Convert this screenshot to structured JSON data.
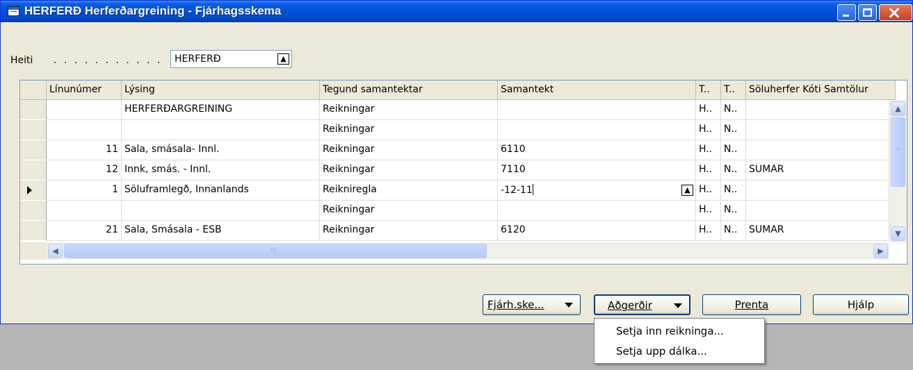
{
  "window": {
    "title": "HERFERÐ Herferðargreining - Fjárhagsskema"
  },
  "header": {
    "heiti_label": "Heiti",
    "heiti_dots": ". . . . . . . . . . .",
    "heiti_value": "HERFERÐ"
  },
  "grid": {
    "columns": {
      "linunumer": "Línunúmer",
      "lysing": "Lýsing",
      "tegund": "Tegund samantektar",
      "samantekt": "Samantekt",
      "t1": "T..",
      "t2": "T..",
      "soluherfer": "Söluherfer Kóti Samtölur"
    },
    "rows": [
      {
        "linunumer": "",
        "lysing": "HERFERÐARGREINING",
        "tegund": "Reikningar",
        "samantekt": "",
        "t1": "H..",
        "t2": "N..",
        "soluherfer": ""
      },
      {
        "linunumer": "",
        "lysing": "",
        "tegund": "Reikningar",
        "samantekt": "",
        "t1": "H..",
        "t2": "N..",
        "soluherfer": ""
      },
      {
        "linunumer": "11",
        "lysing": "Sala, smásala- Innl.",
        "tegund": "Reikningar",
        "samantekt": "6110",
        "t1": "H..",
        "t2": "N..",
        "soluherfer": ""
      },
      {
        "linunumer": "12",
        "lysing": "Innk, smás. - Innl.",
        "tegund": "Reikningar",
        "samantekt": "7110",
        "t1": "H..",
        "t2": "N..",
        "soluherfer": "SUMAR"
      },
      {
        "linunumer": "1",
        "lysing": "Söluframlegð, Innanlands",
        "tegund": "Reikniregla",
        "samantekt": "-12-11",
        "t1": "H..",
        "t2": "N..",
        "soluherfer": ""
      },
      {
        "linunumer": "",
        "lysing": "",
        "tegund": "Reikningar",
        "samantekt": "",
        "t1": "H..",
        "t2": "N..",
        "soluherfer": ""
      },
      {
        "linunumer": "21",
        "lysing": "Sala, Smásala - ESB",
        "tegund": "Reikningar",
        "samantekt": "6120",
        "t1": "H..",
        "t2": "N..",
        "soluherfer": "SUMAR"
      }
    ]
  },
  "buttons": {
    "fjarh": "Fjárh.ske...",
    "adgerdir": "Aðgerðir",
    "prenta": "Prenta",
    "hjalp": "Hjálp"
  },
  "menu": {
    "item1": "Setja inn reikninga...",
    "item2": "Setja upp dálka..."
  },
  "colors": {
    "titlebar": "#0050d8",
    "window_bg": "#ece9d8",
    "desktop": "#b5b5b5",
    "border": "#7f9db9"
  },
  "icons": {
    "lookup": "arrow-up-box-icon",
    "current_row": "row-pointer-icon"
  }
}
